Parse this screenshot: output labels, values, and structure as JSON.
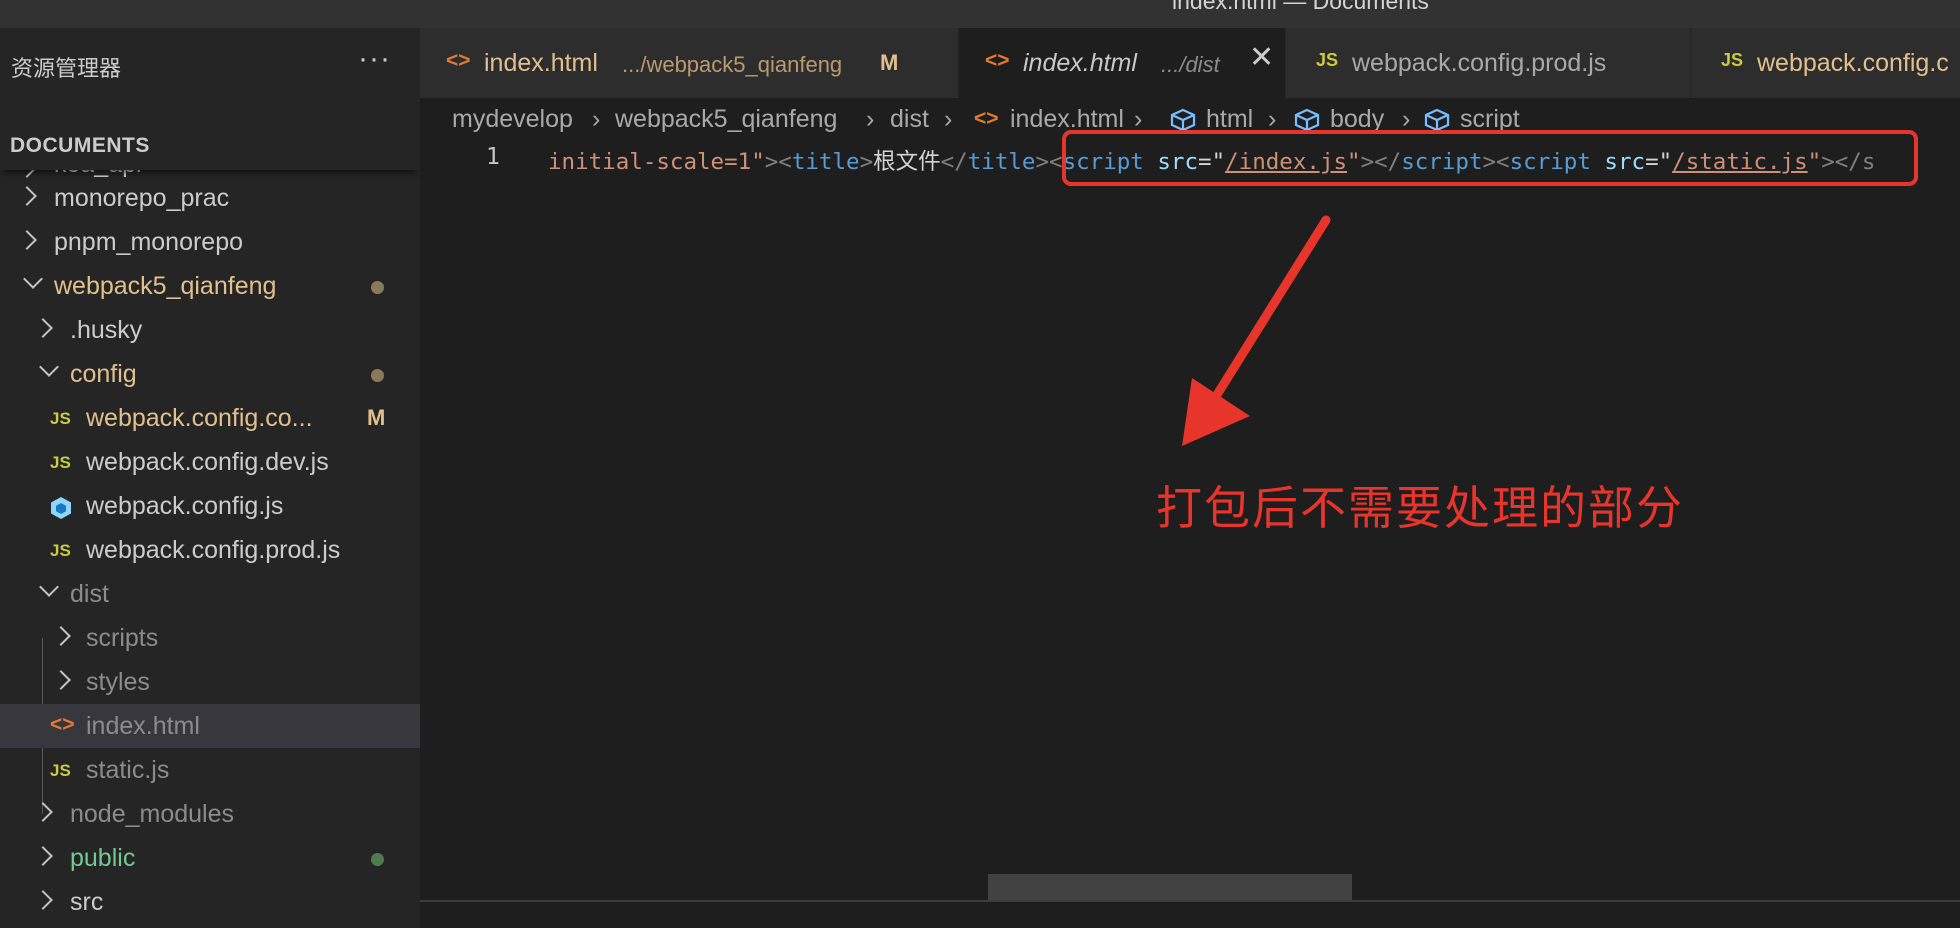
{
  "window": {
    "title": "index.html — Documents"
  },
  "sidebar": {
    "title": "资源管理器",
    "more_label": "···",
    "section_title": "DOCUMENTS",
    "tree": [
      {
        "label": "koa_api",
        "kind": "folder-collapsed"
      },
      {
        "label": "monorepo_prac",
        "kind": "folder-collapsed"
      },
      {
        "label": "pnpm_monorepo",
        "kind": "folder-collapsed"
      },
      {
        "label": "webpack5_qianfeng",
        "kind": "folder-expanded",
        "status": "modified-dot"
      },
      {
        "label": ".husky",
        "kind": "folder-collapsed"
      },
      {
        "label": "config",
        "kind": "folder-expanded",
        "status": "modified-dot"
      },
      {
        "label": "webpack.config.co...",
        "kind": "js-file",
        "badge": "M"
      },
      {
        "label": "webpack.config.dev.js",
        "kind": "js-file"
      },
      {
        "label": "webpack.config.js",
        "kind": "webpack-file"
      },
      {
        "label": "webpack.config.prod.js",
        "kind": "js-file"
      },
      {
        "label": "dist",
        "kind": "folder-expanded"
      },
      {
        "label": "scripts",
        "kind": "folder-collapsed"
      },
      {
        "label": "styles",
        "kind": "folder-collapsed"
      },
      {
        "label": "index.html",
        "kind": "html-file",
        "selected": true
      },
      {
        "label": "static.js",
        "kind": "js-file"
      },
      {
        "label": "node_modules",
        "kind": "folder-collapsed"
      },
      {
        "label": "public",
        "kind": "folder-collapsed",
        "status": "untracked-dot"
      },
      {
        "label": "src",
        "kind": "folder-collapsed"
      }
    ]
  },
  "tabs": [
    {
      "icon": "<>",
      "name": "index.html",
      "desc": ".../webpack5_qianfeng",
      "badge": "M"
    },
    {
      "icon": "<>",
      "name": "index.html",
      "desc": ".../dist",
      "close": "✕",
      "active": true
    },
    {
      "icon": "JS",
      "name": "webpack.config.prod.js"
    },
    {
      "icon": "JS",
      "name": "webpack.config.c"
    }
  ],
  "breadcrumbs": [
    "mydevelop",
    "webpack5_qianfeng",
    "dist",
    "index.html",
    "html",
    "body",
    "script"
  ],
  "breadcrumb_separator": "›",
  "editor": {
    "line_number": "1",
    "code": {
      "t1": "initial-scale=1\"",
      "t2": "><",
      "t3": "title",
      "t4": ">",
      "t5": "根文件",
      "t6": "</",
      "t7": "title",
      "t8": "><",
      "t9": "script",
      "t10": " src",
      "t11": "=\"",
      "t12": "/index.js",
      "t13": "\"",
      "t14": "></",
      "t15": "script",
      "t16": "><",
      "t17": "script",
      "t18": " src",
      "t19": "=\"",
      "t20": "/static.js",
      "t21": "\"",
      "t22": "></s"
    }
  },
  "annotation": {
    "text": "打包后不需要处理的部分",
    "color": "#e8352b"
  },
  "colors": {
    "editor_bg": "#1e1e1e",
    "sidebar_bg": "#252526",
    "modified": "#e2c08d",
    "untracked": "#73c991",
    "js_icon": "#cbcb41",
    "html_icon": "#e37933"
  }
}
